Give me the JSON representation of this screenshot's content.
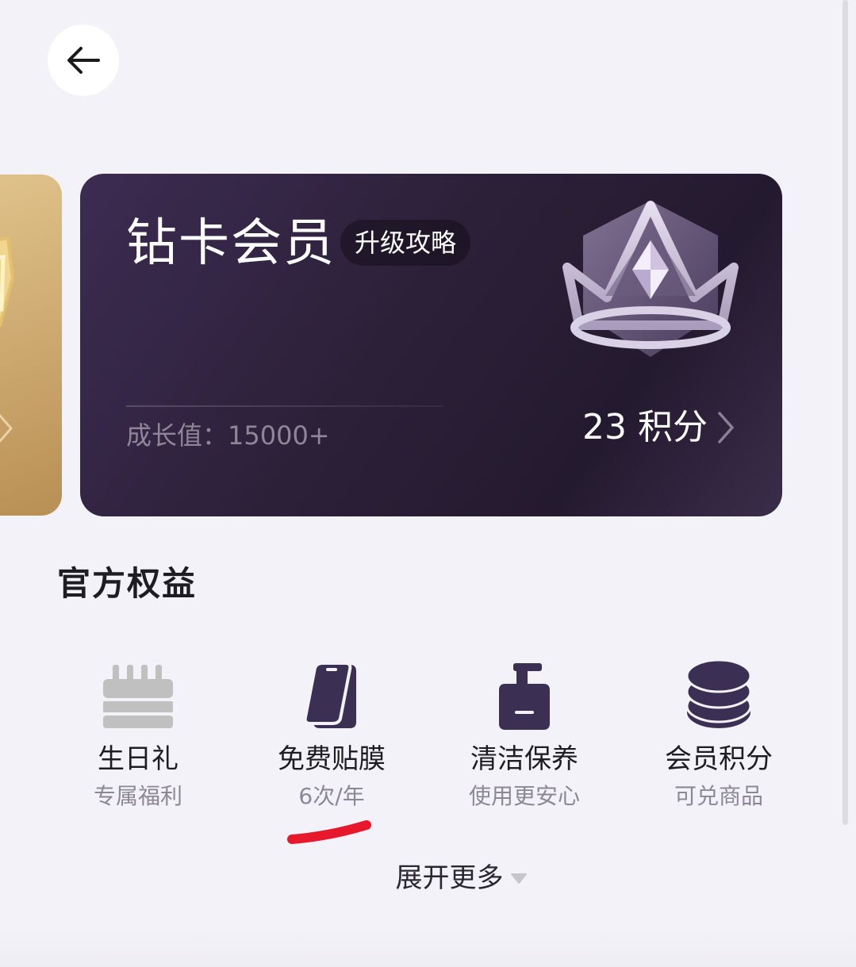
{
  "header": {
    "back_icon": "arrow-left-icon"
  },
  "card": {
    "title": "钻卡会员",
    "upgrade_label": "升级攻略",
    "growth_text": "成长值：15000+",
    "points_text": "23 积分",
    "badge_icon": "diamond-crown-icon",
    "colors": {
      "card_bg": "#2c2038",
      "gold_card_bg": "#c9a46a"
    }
  },
  "section": {
    "title": "官方权益"
  },
  "benefits": [
    {
      "name": "生日礼",
      "desc": "专属福利",
      "icon": "birthday-calendar-icon"
    },
    {
      "name": "免费贴膜",
      "desc": "6次/年",
      "icon": "phone-film-icon"
    },
    {
      "name": "清洁保养",
      "desc": "使用更安心",
      "icon": "cleaning-bottle-icon"
    },
    {
      "name": "会员积分",
      "desc": "可兑商品",
      "icon": "coins-stack-icon"
    }
  ],
  "expand": {
    "label": "展开更多",
    "icon": "caret-down-icon"
  },
  "colors": {
    "accent": "#3b2f54",
    "annotation_red": "#e8182c",
    "muted_icon": "#bfc0bf"
  }
}
